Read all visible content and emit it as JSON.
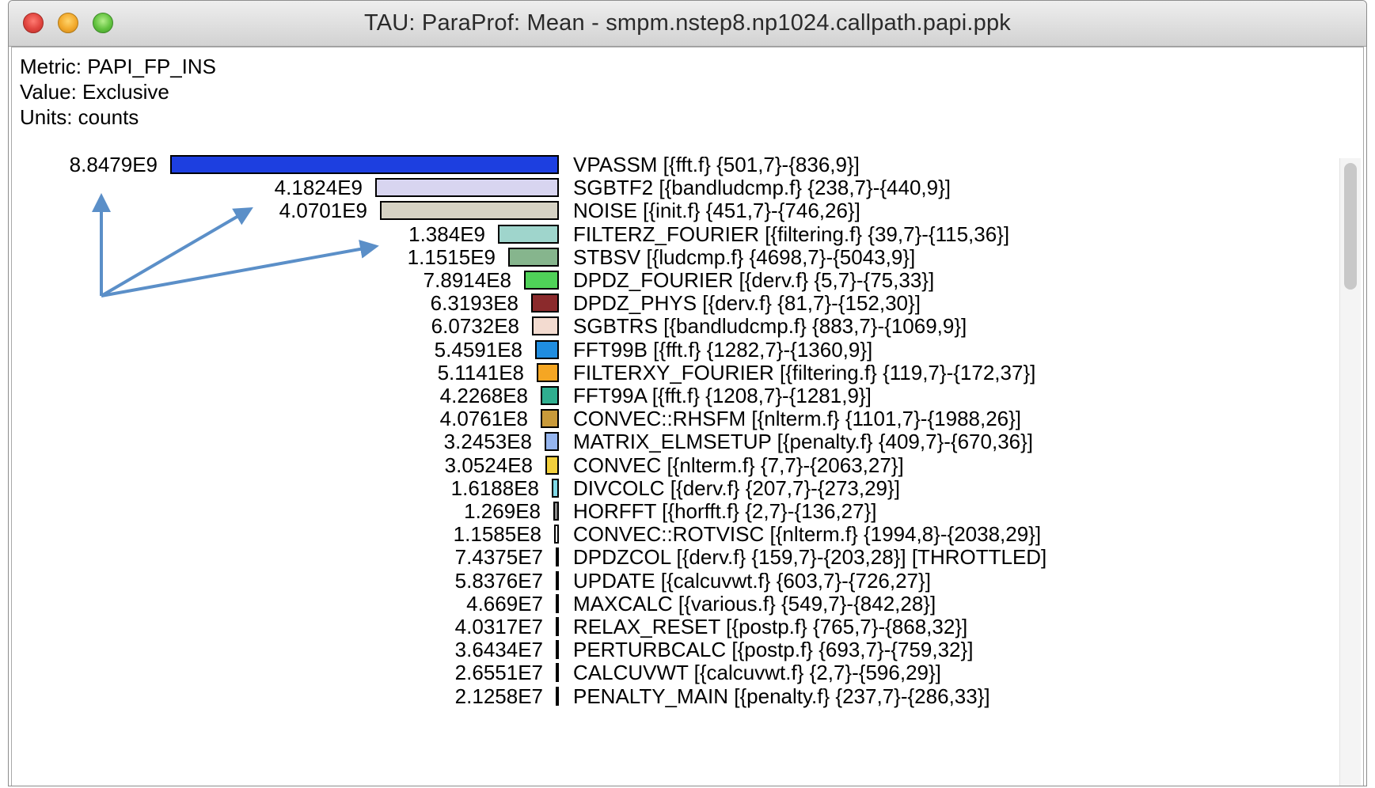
{
  "window": {
    "title": "TAU: ParaProf: Mean - smpm.nstep8.np1024.callpath.papi.ppk"
  },
  "info": {
    "metric": "Metric: PAPI_FP_INS",
    "value": "Value: Exclusive",
    "units": "Units: counts"
  },
  "colors": {
    "arrow": "#5b8fc8"
  },
  "rows": [
    {
      "value": "8.8479E9",
      "amount": 8847900000.0,
      "label": "VPASSM [{fft.f} {501,7}-{836,9}]",
      "color": "#1d3fe0"
    },
    {
      "value": "4.1824E9",
      "amount": 4182400000.0,
      "label": "SGBTF2 [{bandludcmp.f} {238,7}-{440,9}]",
      "color": "#d8d5f0"
    },
    {
      "value": "4.0701E9",
      "amount": 4070100000.0,
      "label": "NOISE [{init.f} {451,7}-{746,26}]",
      "color": "#d6d2c4"
    },
    {
      "value": "1.384E9",
      "amount": 1384000000.0,
      "label": "FILTERZ_FOURIER [{filtering.f} {39,7}-{115,36}]",
      "color": "#9fd5cc"
    },
    {
      "value": "1.1515E9",
      "amount": 1151500000.0,
      "label": "STBSV [{ludcmp.f} {4698,7}-{5043,9}]",
      "color": "#86b58d"
    },
    {
      "value": "7.8914E8",
      "amount": 789140000.0,
      "label": "DPDZ_FOURIER [{derv.f} {5,7}-{75,33}]",
      "color": "#4fd158"
    },
    {
      "value": "6.3193E8",
      "amount": 631930000.0,
      "label": "DPDZ_PHYS [{derv.f} {81,7}-{152,30}]",
      "color": "#8b2a2c"
    },
    {
      "value": "6.0732E8",
      "amount": 607320000.0,
      "label": "SGBTRS [{bandludcmp.f} {883,7}-{1069,9}]",
      "color": "#f3dbd0"
    },
    {
      "value": "5.4591E8",
      "amount": 545910000.0,
      "label": "FFT99B [{fft.f} {1282,7}-{1360,9}]",
      "color": "#1f8de0"
    },
    {
      "value": "5.1141E8",
      "amount": 511410000.0,
      "label": "FILTERXY_FOURIER [{filtering.f} {119,7}-{172,37}]",
      "color": "#f5a623"
    },
    {
      "value": "4.2268E8",
      "amount": 422680000.0,
      "label": "FFT99A [{fft.f} {1208,7}-{1281,9}]",
      "color": "#2fae8f"
    },
    {
      "value": "4.0761E8",
      "amount": 407610000.0,
      "label": "CONVEC::RHSFM [{nlterm.f} {1101,7}-{1988,26}]",
      "color": "#c99a3a"
    },
    {
      "value": "3.2453E8",
      "amount": 324530000.0,
      "label": "MATRIX_ELMSETUP [{penalty.f} {409,7}-{670,36}]",
      "color": "#95b5ef"
    },
    {
      "value": "3.0524E8",
      "amount": 305240000.0,
      "label": "CONVEC [{nlterm.f} {7,7}-{2063,27}]",
      "color": "#f2cf3c"
    },
    {
      "value": "1.6188E8",
      "amount": 161880000.0,
      "label": "DIVCOLC [{derv.f} {207,7}-{273,29}]",
      "color": "#7fd8e6"
    },
    {
      "value": "1.269E8",
      "amount": 126900000.0,
      "label": "HORFFT [{horfft.f} {2,7}-{136,27}]",
      "color": "#8a8a8a"
    },
    {
      "value": "1.1585E8",
      "amount": 115850000.0,
      "label": "CONVEC::ROTVISC [{nlterm.f} {1994,8}-{2038,29}]",
      "color": "#ffffff"
    },
    {
      "value": "7.4375E7",
      "amount": 74375000.0,
      "label": "DPDZCOL [{derv.f} {159,7}-{203,28}] [THROTTLED]",
      "color": "#3344bb"
    },
    {
      "value": "5.8376E7",
      "amount": 58376000.0,
      "label": "UPDATE [{calcuvwt.f} {603,7}-{726,27}]",
      "color": "#000000"
    },
    {
      "value": "4.669E7",
      "amount": 46690000.0,
      "label": "MAXCALC [{various.f} {549,7}-{842,28}]",
      "color": "#000000"
    },
    {
      "value": "4.0317E7",
      "amount": 40317000.0,
      "label": "RELAX_RESET [{postp.f} {765,7}-{868,32}]",
      "color": "#000000"
    },
    {
      "value": "3.6434E7",
      "amount": 36434000.0,
      "label": "PERTURBCALC [{postp.f} {693,7}-{759,32}]",
      "color": "#000000"
    },
    {
      "value": "2.6551E7",
      "amount": 26551000.0,
      "label": "CALCUVWT [{calcuvwt.f} {2,7}-{596,29}]",
      "color": "#000000"
    },
    {
      "value": "2.1258E7",
      "amount": 21258000.0,
      "label": "PENALTY_MAIN [{penalty.f} {237,7}-{286,33}]",
      "color": "#000000"
    }
  ]
}
